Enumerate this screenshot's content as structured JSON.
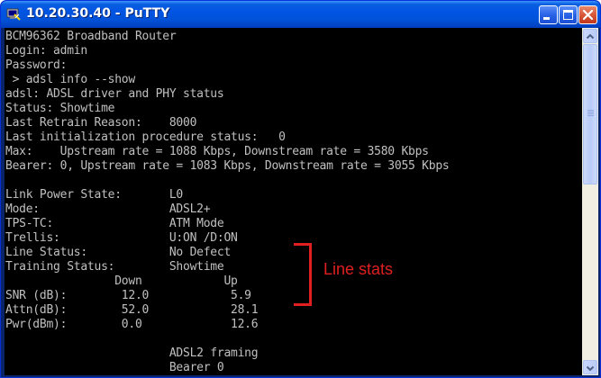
{
  "window": {
    "title": "10.20.30.40 - PuTTY",
    "icon": "putty-app-icon",
    "controls": [
      "minimize-icon",
      "maximize-icon",
      "close-icon"
    ]
  },
  "terminal": {
    "lines": [
      "BCM96362 Broadband Router",
      "Login: admin",
      "Password:",
      " > adsl info --show",
      "adsl: ADSL driver and PHY status",
      "Status: Showtime",
      "Last Retrain Reason:    8000",
      "Last initialization procedure status:   0",
      "Max:    Upstream rate = 1088 Kbps, Downstream rate = 3580 Kbps",
      "Bearer: 0, Upstream rate = 1083 Kbps, Downstream rate = 3055 Kbps",
      "",
      "Link Power State:       L0",
      "Mode:                   ADSL2+",
      "TPS-TC:                 ATM Mode",
      "Trellis:                U:ON /D:ON",
      "Line Status:            No Defect",
      "Training Status:        Showtime",
      "                Down            Up",
      "SNR (dB):        12.0            5.9",
      "Attn(dB):        52.0            28.1",
      "Pwr(dBm):        0.0             12.6",
      "",
      "                        ADSL2 framing",
      "                        Bearer 0"
    ],
    "colors": {
      "background": "#000000",
      "text": "#c0c0c0"
    }
  },
  "annotation": {
    "label": "Line stats",
    "color": "#e02020"
  }
}
